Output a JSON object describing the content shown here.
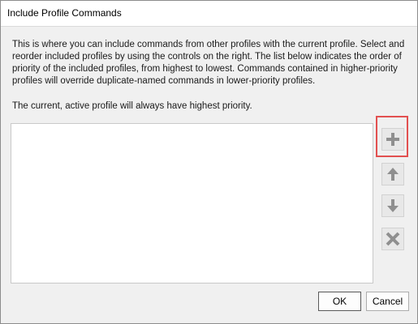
{
  "window": {
    "title": "Include Profile Commands"
  },
  "description": {
    "lines": [
      "This is where you can include commands from other profiles with the current profile.  Select and",
      "reorder included profiles by using the controls on the right.  The list below indicates the order of",
      "priority of the included profiles, from highest to lowest.  Commands contained in higher-priority",
      "profiles will override duplicate-named commands in lower-priority profiles."
    ],
    "note": "The current, active profile will always have highest priority."
  },
  "profile_list": {
    "items": []
  },
  "controls": {
    "add": {
      "icon": "plus-icon"
    },
    "move_up": {
      "icon": "arrow-up-icon"
    },
    "move_down": {
      "icon": "arrow-down-icon"
    },
    "remove": {
      "icon": "x-icon"
    }
  },
  "buttons": {
    "ok_label": "OK",
    "cancel_label": "Cancel"
  },
  "colors": {
    "highlight_border": "#e25050",
    "icon_gray": "#8f8f8f"
  }
}
